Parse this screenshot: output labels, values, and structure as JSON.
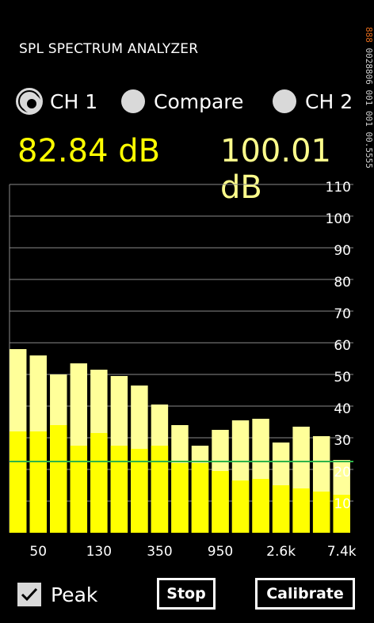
{
  "app": {
    "title": "SPL SPECTRUM ANALYZER"
  },
  "channels": {
    "ch1_label": "CH 1",
    "compare_label": "Compare",
    "ch2_label": "CH 2",
    "selected": "ch1"
  },
  "readings": {
    "ch1": "82.84 dB",
    "ch2": "100.01 dB"
  },
  "side_strip": {
    "part1": "888",
    "part2": "0028806 001 001 00.5555"
  },
  "controls": {
    "peak_label": "Peak",
    "peak_checked": true,
    "stop_label": "Stop",
    "calibrate_label": "Calibrate"
  },
  "colors": {
    "level_bar": "#ffff00",
    "peak_bar": "#ffff99",
    "threshold_line": "#2db34a",
    "grid": "#8a8a8a",
    "accent_ch2": "#ffff8c"
  },
  "chart_data": {
    "type": "bar",
    "title": "",
    "xlabel": "",
    "ylabel": "",
    "ylim": [
      0,
      110
    ],
    "y_ticks": [
      10,
      20,
      30,
      40,
      50,
      60,
      70,
      80,
      90,
      100,
      110
    ],
    "x_tick_labels": [
      "50",
      "130",
      "350",
      "950",
      "2.6k",
      "7.4k"
    ],
    "grid": true,
    "threshold": 22.5,
    "series": [
      {
        "name": "",
        "values": [
          32,
          32,
          34,
          27.5,
          31.5,
          27.5,
          26.5,
          27.5,
          22,
          22,
          19.5,
          16.5,
          17,
          15,
          14,
          13,
          12
        ]
      },
      {
        "name": "",
        "values": [
          58,
          56,
          50,
          53.5,
          51.5,
          49.5,
          46.5,
          40.5,
          34,
          27.5,
          32.5,
          35.5,
          36,
          28.5,
          33.5,
          30.5,
          23
        ]
      }
    ]
  }
}
